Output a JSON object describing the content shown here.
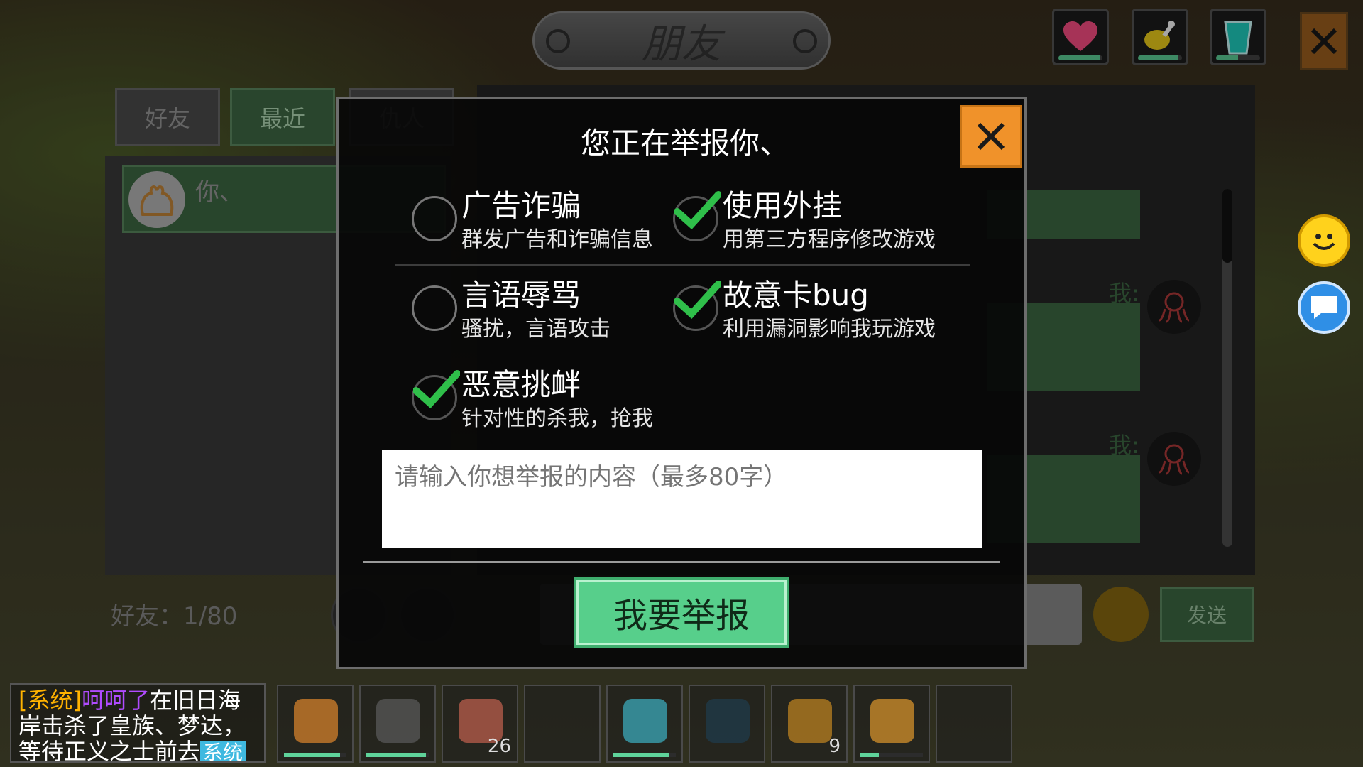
{
  "header": {
    "title": "朋友"
  },
  "stats": {
    "health": 0.95,
    "hunger": 0.9,
    "thirst": 0.5
  },
  "tabs": [
    {
      "label": "好友"
    },
    {
      "label": "最近"
    },
    {
      "label": "仇人"
    }
  ],
  "friends": {
    "selected_name": "你、",
    "count_label": "好友：1/80"
  },
  "chat_panel": {
    "me_label": "我:",
    "send_label": "发送"
  },
  "dialog": {
    "title": "您正在举报你、",
    "options": [
      {
        "title": "广告诈骗",
        "desc": "群发广告和诈骗信息",
        "checked": false
      },
      {
        "title": "使用外挂",
        "desc": "用第三方程序修改游戏",
        "checked": true
      },
      {
        "title": "言语辱骂",
        "desc": "骚扰，言语攻击",
        "checked": false
      },
      {
        "title": "故意卡bug",
        "desc": "利用漏洞影响我玩游戏",
        "checked": true
      },
      {
        "title": "恶意挑衅",
        "desc": "针对性的杀我，抢我",
        "checked": true
      }
    ],
    "input_placeholder": "请输入你想举报的内容（最多80字）",
    "submit_label": "我要举报"
  },
  "chat_log": {
    "system_tag": "[系统]",
    "player": "呵呵了",
    "text": "在旧日海岸击杀了皇族、梦达，等待正义之士前去",
    "badge": "系统"
  },
  "hotbar": [
    {
      "icon": "pickaxe-icon",
      "count": "",
      "durability": 0.9
    },
    {
      "icon": "dark-pickaxe-icon",
      "count": "",
      "durability": 0.95
    },
    {
      "icon": "meat-icon",
      "count": "26",
      "durability": null
    },
    {
      "icon": "empty-slot",
      "count": "",
      "durability": null
    },
    {
      "icon": "spear-icon",
      "count": "",
      "durability": 0.9
    },
    {
      "icon": "orb-icon",
      "count": "",
      "durability": null
    },
    {
      "icon": "acorn-icon",
      "count": "9",
      "durability": null
    },
    {
      "icon": "axe-icon",
      "count": "",
      "durability": 0.3
    },
    {
      "icon": "empty-slot",
      "count": "",
      "durability": null
    }
  ],
  "colors": {
    "accent_green": "#57cf8b",
    "close_orange": "#f0922a",
    "check_green": "#2fbf4a"
  }
}
